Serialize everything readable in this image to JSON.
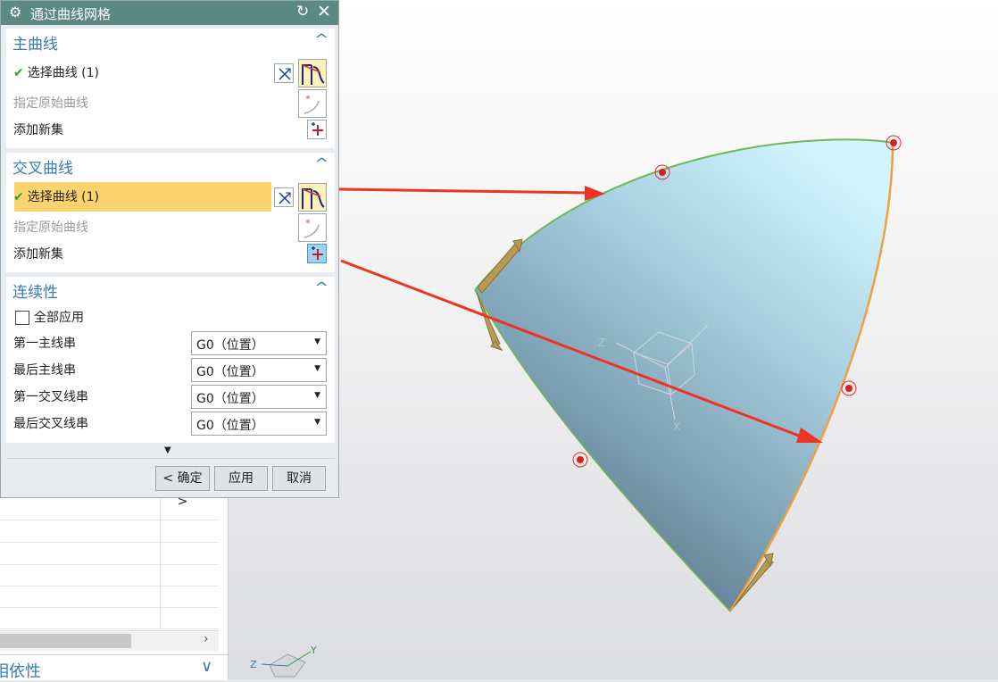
{
  "dialog": {
    "title": "通过曲线网格",
    "primary_group": {
      "heading": "主曲线",
      "select_curve_label": "选择曲线 (1)",
      "specify_origin_label": "指定原始曲线",
      "add_new_set_label": "添加新集"
    },
    "cross_group": {
      "heading": "交叉曲线",
      "select_curve_label": "选择曲线 (1)",
      "specify_origin_label": "指定原始曲线",
      "add_new_set_label": "添加新集"
    },
    "continuity_group": {
      "heading": "连续性",
      "apply_all_label": "全部应用",
      "rows": [
        {
          "label": "第一主线串",
          "value": "G0（位置）"
        },
        {
          "label": "最后主线串",
          "value": "G0（位置）"
        },
        {
          "label": "第一交叉线串",
          "value": "G0（位置）"
        },
        {
          "label": "最后交叉线串",
          "value": "G0（位置）"
        }
      ]
    },
    "buttons": {
      "ok": "< 确定 >",
      "apply": "应用",
      "cancel": "取消"
    }
  },
  "navigator": {
    "dependency_label": "相依性"
  },
  "triad": {
    "x": "X",
    "y": "Y",
    "z": "Z"
  },
  "colors": {
    "title_bar": "#5b8a84",
    "group_heading": "#3a7bb0",
    "selected_row": "#fbd36f",
    "surface_light": "#c9eefb",
    "surface_dark": "#5a7a8c",
    "primary_edge": "#6fb858",
    "cross_edge": "#f0a040",
    "annotation_arrow": "#ee3322"
  }
}
